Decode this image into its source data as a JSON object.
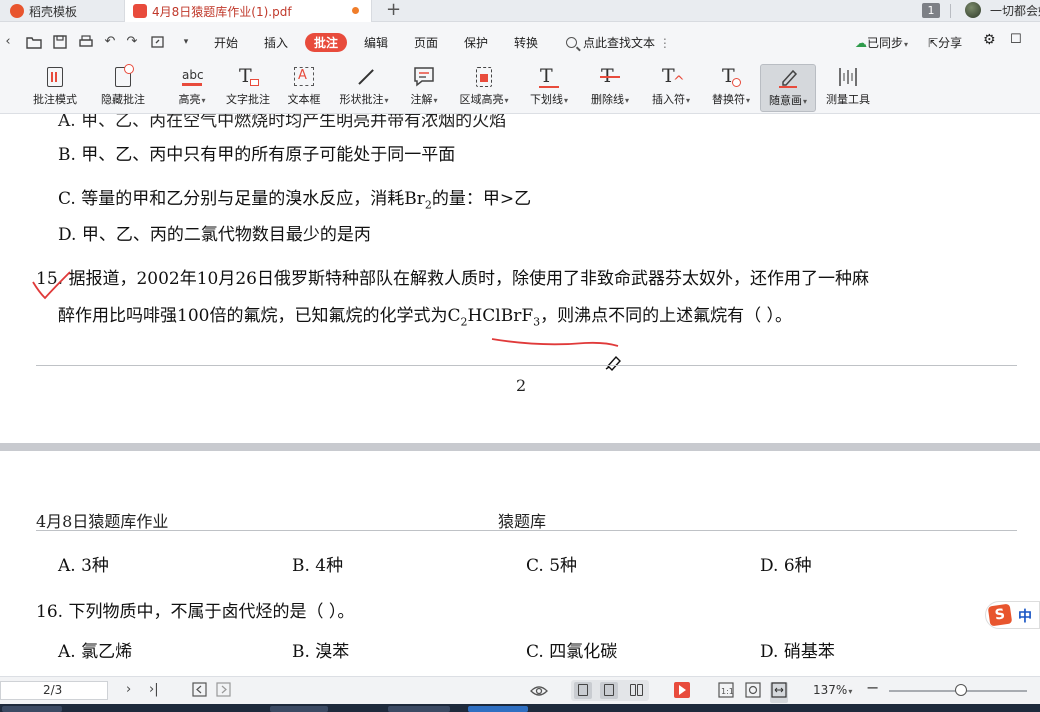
{
  "tabs": [
    {
      "label": "稻壳模板"
    },
    {
      "label": "4月8日猿题库作业(1).pdf"
    }
  ],
  "new_tab_label": "+",
  "page_badge": "1",
  "user_name": "一切都会好",
  "menu": [
    "开始",
    "插入",
    "批注",
    "编辑",
    "页面",
    "保护",
    "转换"
  ],
  "active_menu": "批注",
  "search_label": "点此查找文本",
  "sync_label": "已同步",
  "share_label": "分享",
  "ribbon": [
    {
      "label": "批注模式",
      "icon": "annotation-mode-icon"
    },
    {
      "label": "隐藏批注",
      "icon": "hide-annotation-icon"
    },
    {
      "label": "高亮",
      "icon": "highlight-icon",
      "dropdown": true
    },
    {
      "label": "文字批注",
      "icon": "text-annotation-icon"
    },
    {
      "label": "文本框",
      "icon": "textbox-icon"
    },
    {
      "label": "形状批注",
      "icon": "shape-annotation-icon",
      "dropdown": true
    },
    {
      "label": "注解",
      "icon": "note-icon",
      "dropdown": true
    },
    {
      "label": "区域高亮",
      "icon": "area-highlight-icon",
      "dropdown": true
    },
    {
      "label": "下划线",
      "icon": "underline-icon",
      "dropdown": true
    },
    {
      "label": "删除线",
      "icon": "strikethrough-icon",
      "dropdown": true
    },
    {
      "label": "插入符",
      "icon": "insert-caret-icon",
      "dropdown": true
    },
    {
      "label": "替换符",
      "icon": "replace-icon",
      "dropdown": true
    },
    {
      "label": "随意画",
      "icon": "freehand-draw-icon",
      "dropdown": true,
      "selected": true
    },
    {
      "label": "测量工具",
      "icon": "measure-icon"
    }
  ],
  "document": {
    "q14_optB": "B. 甲、乙、丙中只有甲的所有原子可能处于同一平面",
    "q14_optC_pre": "C. 等量的甲和乙分别与足量的溴水反应，消耗Br",
    "q14_optC_sub": "2",
    "q14_optC_post": "的量：甲>乙",
    "q14_optD": "D. 甲、乙、丙的二氯代物数目最少的是丙",
    "q15_line1": "15. 据报道，2002年10月26日俄罗斯特种部队在解救人质时，除使用了非致命武器芬太奴外，还作用了一种麻",
    "q15_line2_pre": "醉作用比吗啡强100倍的氟烷，已知氟烷的化学式为C",
    "q15_sub1": "2",
    "q15_line2_mid": "HClBrF",
    "q15_sub2": "3",
    "q15_line2_post": "，则沸点不同的上述氟烷有（  ）。",
    "page_number": "2",
    "header_left": "4月8日猿题库作业",
    "header_mid": "猿题库",
    "q15_options": [
      "A. 3种",
      "B. 4种",
      "C. 5种",
      "D. 6种"
    ],
    "q16": "16. 下列物质中，不属于卤代烃的是（  ）。",
    "q16_options": [
      "A. 氯乙烯",
      "B. 溴苯",
      "C. 四氯化碳",
      "D. 硝基苯"
    ]
  },
  "ime_label": "中",
  "status": {
    "page_indicator": "2/3",
    "zoom": "137%",
    "zoom_fraction": 0.52
  },
  "colors": {
    "accent": "#e84b3c",
    "ink": "#e03a3a"
  }
}
